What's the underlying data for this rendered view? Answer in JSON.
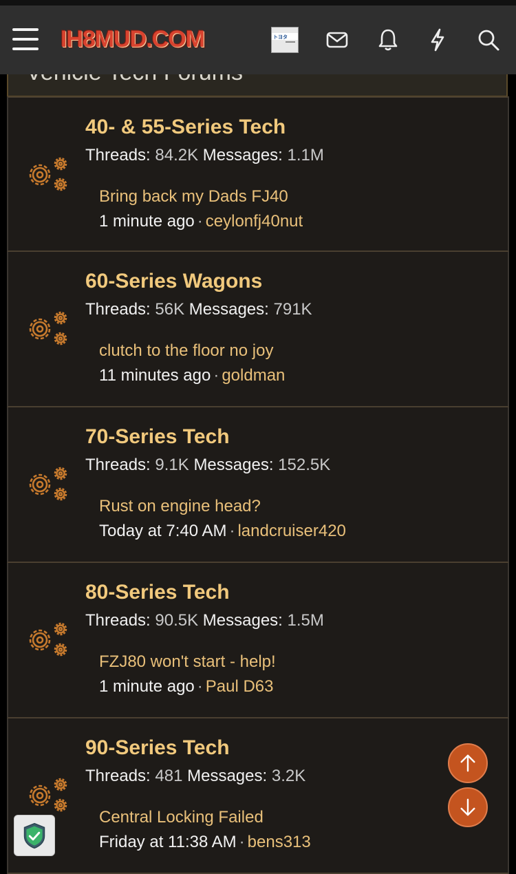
{
  "header": {
    "logo_text": "IH8MUD.COM",
    "avatar_text": "トヨタ"
  },
  "section": {
    "title": "Vehicle Tech Forums"
  },
  "nodes": [
    {
      "title": "40- & 55-Series Tech",
      "threads_label": "Threads:",
      "threads": "84.2K",
      "messages_label": "Messages:",
      "messages": "1.1M",
      "latest_title": "Bring back my Dads FJ40",
      "latest_time": "1 minute ago",
      "latest_user": "ceylonfj40nut"
    },
    {
      "title": "60-Series Wagons",
      "threads_label": "Threads:",
      "threads": "56K",
      "messages_label": "Messages:",
      "messages": "791K",
      "latest_title": "clutch to the floor no joy",
      "latest_time": "11 minutes ago",
      "latest_user": "goldman"
    },
    {
      "title": "70-Series Tech",
      "threads_label": "Threads:",
      "threads": "9.1K",
      "messages_label": "Messages:",
      "messages": "152.5K",
      "latest_title": "Rust on engine head?",
      "latest_time": "Today at 7:40 AM",
      "latest_user": "landcruiser420"
    },
    {
      "title": "80-Series Tech",
      "threads_label": "Threads:",
      "threads": "90.5K",
      "messages_label": "Messages:",
      "messages": "1.5M",
      "latest_title": "FZJ80 won't start - help!",
      "latest_time": "1 minute ago",
      "latest_user": "Paul D63"
    },
    {
      "title": "90-Series Tech",
      "threads_label": "Threads:",
      "threads": "481",
      "messages_label": "Messages:",
      "messages": "3.2K",
      "latest_title": "Central Locking Failed",
      "latest_time": "Friday at 11:38 AM",
      "latest_user": "bens313"
    }
  ],
  "colors": {
    "accent": "#f1c97d",
    "link": "#e9c07a",
    "button": "#c4541f",
    "background": "#1e1b18"
  },
  "icons": [
    "menu-icon",
    "mail-icon",
    "bell-icon",
    "bolt-icon",
    "search-icon",
    "gears-icon",
    "arrow-up-icon",
    "arrow-down-icon",
    "shield-icon"
  ]
}
